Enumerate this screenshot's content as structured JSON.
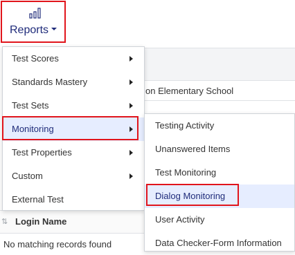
{
  "reports_button": {
    "label": "Reports",
    "icon": "bar-chart-icon"
  },
  "menu": {
    "items": [
      {
        "label": "Test Scores",
        "has_submenu": true
      },
      {
        "label": "Standards Mastery",
        "has_submenu": true
      },
      {
        "label": "Test Sets",
        "has_submenu": true
      },
      {
        "label": "Monitoring",
        "has_submenu": true,
        "active": true
      },
      {
        "label": "Test Properties",
        "has_submenu": true
      },
      {
        "label": "Custom",
        "has_submenu": true
      },
      {
        "label": "External Test",
        "has_submenu": false
      }
    ]
  },
  "submenu": {
    "items": [
      {
        "label": "Testing Activity"
      },
      {
        "label": "Unanswered Items"
      },
      {
        "label": "Test Monitoring"
      },
      {
        "label": "Dialog Monitoring",
        "active": true
      },
      {
        "label": "User Activity"
      },
      {
        "label": "Data Checker-Form Information"
      }
    ]
  },
  "background": {
    "school_text": "on Elementary School",
    "table_header": "Login Name",
    "empty_text": "No matching records found"
  },
  "colors": {
    "highlight": "#e1141b",
    "accent": "#1f2b7a",
    "active_bg": "#e6edff"
  }
}
